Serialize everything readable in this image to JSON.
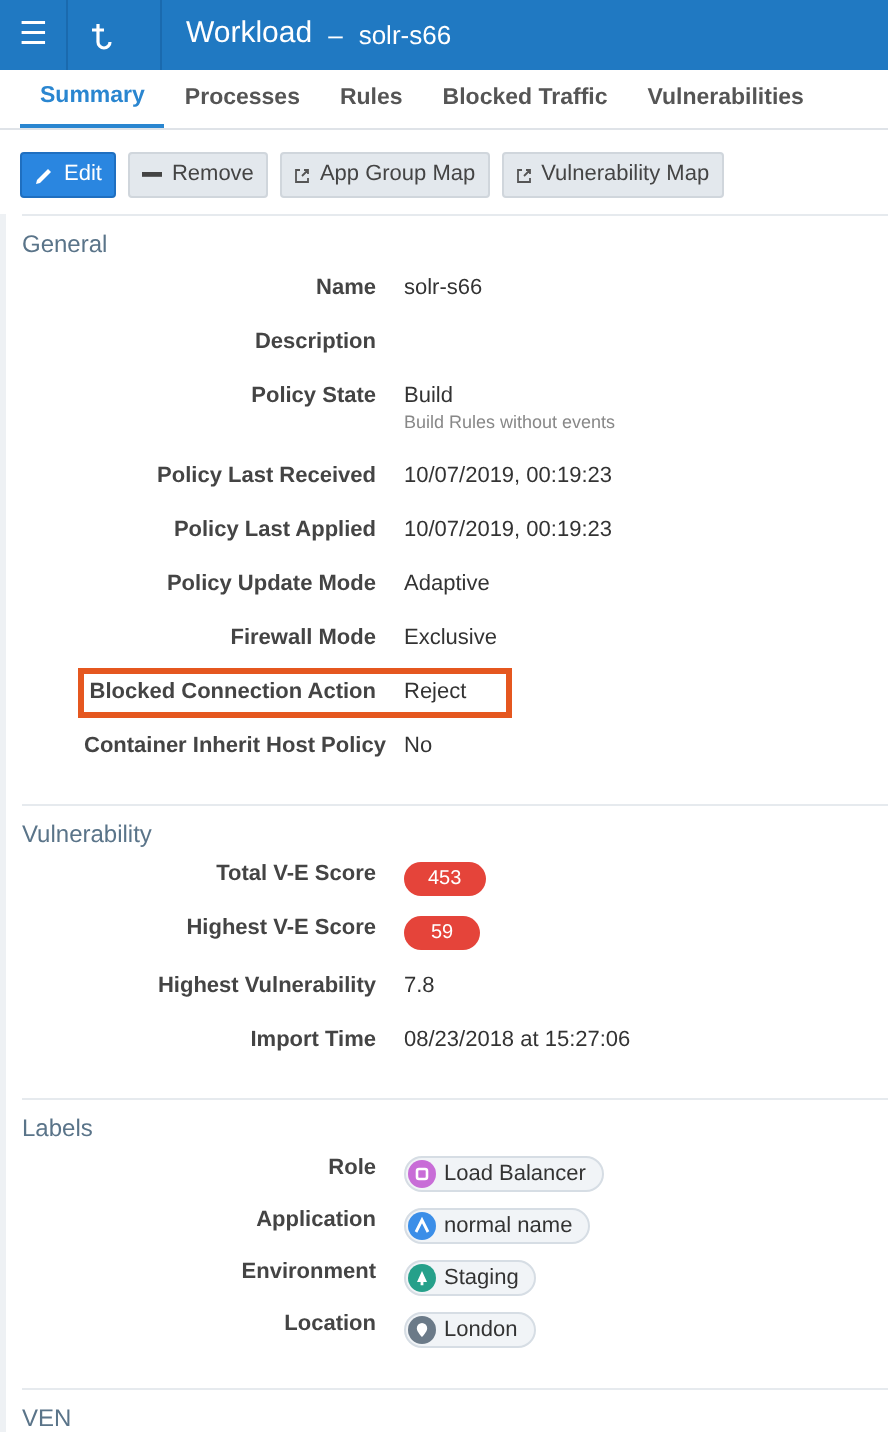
{
  "header": {
    "menu": "☰",
    "title": "Workload",
    "separator": "–",
    "subtitle": "solr-s66"
  },
  "tabs": [
    {
      "label": "Summary",
      "selected": true
    },
    {
      "label": "Processes",
      "selected": false
    },
    {
      "label": "Rules",
      "selected": false
    },
    {
      "label": "Blocked Traffic",
      "selected": false
    },
    {
      "label": "Vulnerabilities",
      "selected": false
    }
  ],
  "toolbar": [
    {
      "label": "Edit",
      "kind": "primary"
    },
    {
      "label": "Remove",
      "kind": "remove"
    },
    {
      "label": "App Group Map",
      "kind": "link"
    },
    {
      "label": "Vulnerability Map",
      "kind": "link"
    }
  ],
  "sections": [
    {
      "title": "General",
      "rows": [
        {
          "label": "Name",
          "value": "solr-s66",
          "kind": "text",
          "highlighted": false
        },
        {
          "label": "Description",
          "kind": "text",
          "highlighted": false
        },
        {
          "label": "Policy State",
          "value": "Build",
          "note": "Build Rules without events",
          "kind": "text",
          "highlighted": false
        },
        {
          "label": "Policy Last Received",
          "value": "10/07/2019, 00:19:23",
          "kind": "text",
          "highlighted": false
        },
        {
          "label": "Policy Last Applied",
          "value": "10/07/2019, 00:19:23",
          "kind": "text",
          "highlighted": false
        },
        {
          "label": "Policy Update Mode",
          "value": "Adaptive",
          "kind": "text",
          "highlighted": false
        },
        {
          "label": "Firewall Mode",
          "value": "Exclusive",
          "kind": "text",
          "highlighted": false
        },
        {
          "label": "Blocked Connection Action",
          "value": "Reject",
          "kind": "text",
          "highlighted": true
        },
        {
          "label": "Container Inherit Host Policy",
          "value": "No",
          "kind": "text",
          "highlighted": false
        }
      ]
    },
    {
      "title": "Vulnerability",
      "rows": [
        {
          "label": "Total V-E Score",
          "value": "453",
          "kind": "badge",
          "highlighted": false
        },
        {
          "label": "Highest V-E Score",
          "value": "59",
          "kind": "badge",
          "highlighted": false
        },
        {
          "label": "Highest Vulnerability",
          "value": "7.8",
          "kind": "text",
          "highlighted": false
        },
        {
          "label": "Import Time",
          "value": "08/23/2018 at 15:27:06",
          "kind": "text",
          "highlighted": false
        }
      ]
    },
    {
      "title": "Labels",
      "rows": [
        {
          "label": "Role",
          "value": "Load Balancer",
          "kind": "label",
          "color": "#c86dd7",
          "highlighted": false
        },
        {
          "label": "Application",
          "value": "normal name",
          "kind": "label",
          "color": "#3b8ee8",
          "highlighted": false
        },
        {
          "label": "Environment",
          "value": "Staging",
          "kind": "label",
          "color": "#26a08a",
          "highlighted": false
        },
        {
          "label": "Location",
          "value": "London",
          "kind": "label",
          "color": "#6b7a88",
          "highlighted": false
        }
      ]
    },
    {
      "title": "VEN"
    }
  ]
}
